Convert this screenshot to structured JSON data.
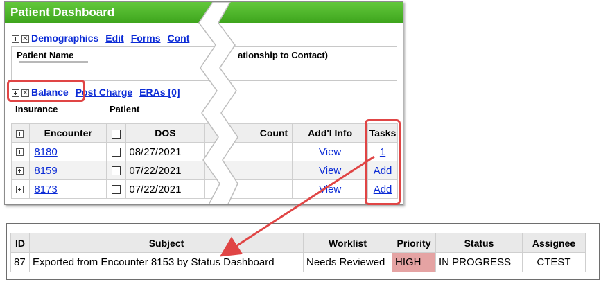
{
  "dashboard": {
    "title": "Patient Dashboard",
    "demographics_link": "Demographics",
    "nav_links": [
      "Edit",
      "Forms",
      "Cont"
    ],
    "patient_name_label": "Patient Name",
    "relationship_label": "ationship to Contact)",
    "balance_link": "Balance",
    "balance_links": [
      "Post Charge",
      "ERAs [0]"
    ],
    "insurance_label": "Insurance",
    "patient_label": "Patient",
    "grid": {
      "headers": {
        "encounter": "Encounter",
        "dos": "DOS",
        "count": "Count",
        "addl_info": "Add'l Info",
        "tasks": "Tasks"
      },
      "rows": [
        {
          "encounter": "8180",
          "dos": "08/27/2021",
          "info": "View",
          "task": "1"
        },
        {
          "encounter": "8159",
          "dos": "07/22/2021",
          "info": "View",
          "task": "Add"
        },
        {
          "encounter": "8173",
          "dos": "07/22/2021",
          "info": "View",
          "task": "Add"
        }
      ]
    }
  },
  "task_list": {
    "headers": [
      "ID",
      "Subject",
      "Worklist",
      "Priority",
      "Status",
      "Assignee"
    ],
    "rows": [
      {
        "id": "87",
        "subject": "Exported from Encounter 8153 by Status Dashboard",
        "worklist": "Needs Reviewed",
        "priority": "HIGH",
        "status": "IN PROGRESS",
        "assignee": "CTEST"
      }
    ]
  },
  "colors": {
    "header_green": "#4fb52a",
    "link_blue": "#0b2bd6",
    "highlight_red": "#e04545",
    "priority_high": "#e5a3a3"
  }
}
